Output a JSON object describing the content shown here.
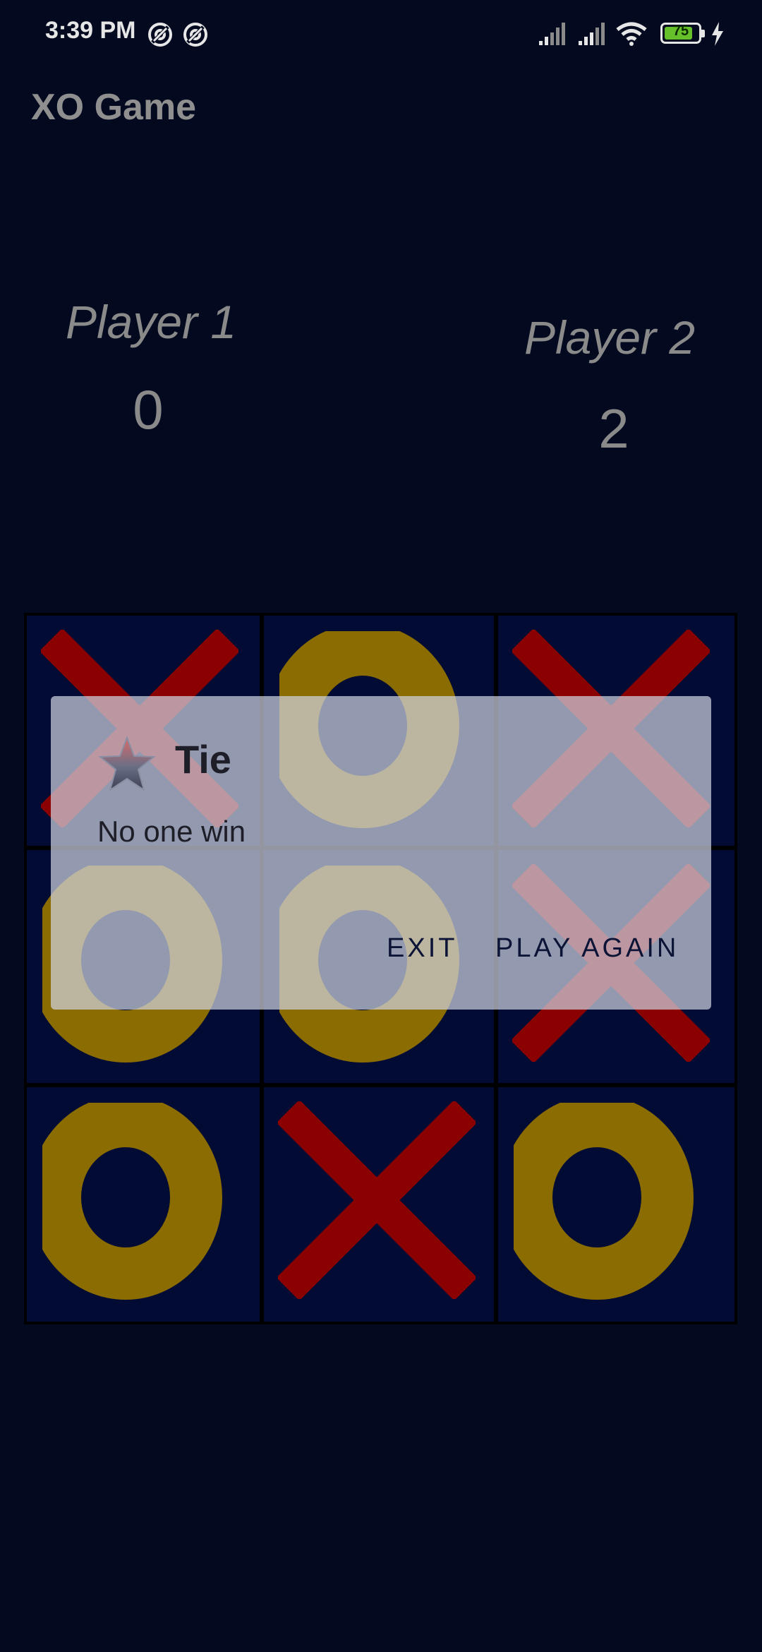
{
  "status_bar": {
    "time": "3:39 PM",
    "battery_level": "75",
    "icons": [
      "sync-icon",
      "sync-icon",
      "signal-icon",
      "signal-icon",
      "wifi-icon",
      "battery-icon",
      "charging-icon"
    ]
  },
  "app": {
    "title": "XO Game"
  },
  "players": [
    {
      "name": "Player 1",
      "score": "0"
    },
    {
      "name": "Player 2",
      "score": "2"
    }
  ],
  "board": {
    "cells": [
      "X",
      "O",
      "X",
      "O",
      "O",
      "X",
      "O",
      "X",
      "O"
    ],
    "colors": {
      "x": "#8b0000",
      "o": "#8a6c00",
      "cell_bg": "#020b33"
    }
  },
  "dialog": {
    "icon": "star-icon",
    "title": "Tie",
    "message": "No one win",
    "buttons": {
      "exit": "EXIT",
      "play_again": "PLAY AGAIN"
    }
  }
}
